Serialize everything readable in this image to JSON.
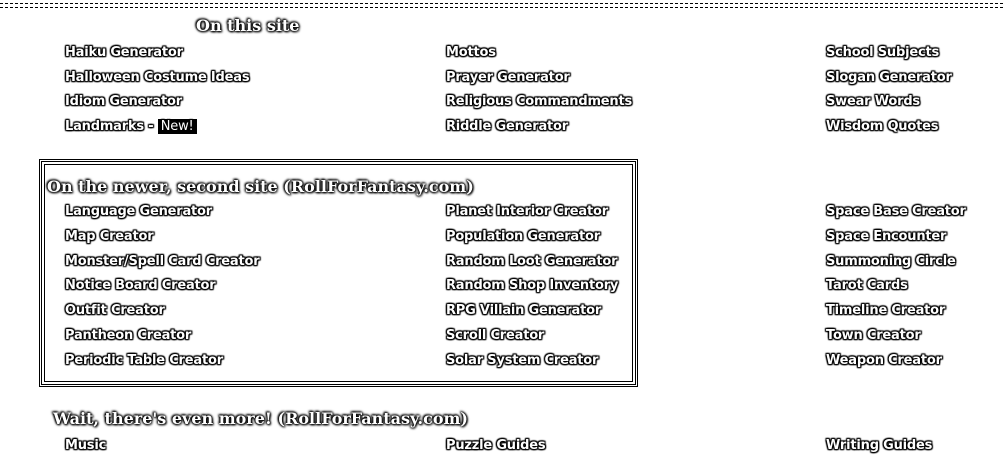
{
  "section1": {
    "heading": "On this site",
    "col1": [
      "Haiku Generator",
      "Halloween Costume Ideas",
      "Idiom Generator",
      "Landmarks - "
    ],
    "badge": "New!",
    "col2": [
      "Mottos",
      "Prayer Generator",
      "Religious Commandments",
      "Riddle Generator"
    ],
    "col3": [
      "School Subjects",
      "Slogan Generator",
      "Swear Words",
      "Wisdom Quotes"
    ]
  },
  "section2": {
    "heading": "On the newer, second site (RollForFantasy.com)",
    "col1": [
      "Language Generator",
      "Map Creator",
      "Monster/Spell Card Creator",
      "Notice Board Creator",
      "Outfit Creator",
      "Pantheon Creator",
      "Periodic Table Creator"
    ],
    "col2": [
      "Planet Interior Creator",
      "Population Generator",
      "Random Loot Generator",
      "Random Shop Inventory",
      "RPG Villain Generator",
      "Scroll Creator",
      "Solar System Creator"
    ],
    "col3": [
      "Space Base Creator",
      "Space Encounter",
      "Summoning Circle",
      "Tarot Cards",
      "Timeline Creator",
      "Town Creator",
      "Weapon Creator"
    ]
  },
  "section3": {
    "heading": "Wait, there's even more! (RollForFantasy.com)",
    "col1": [
      "Music"
    ],
    "col2": [
      "Puzzle Guides"
    ],
    "col3": [
      "Writing Guides"
    ]
  }
}
